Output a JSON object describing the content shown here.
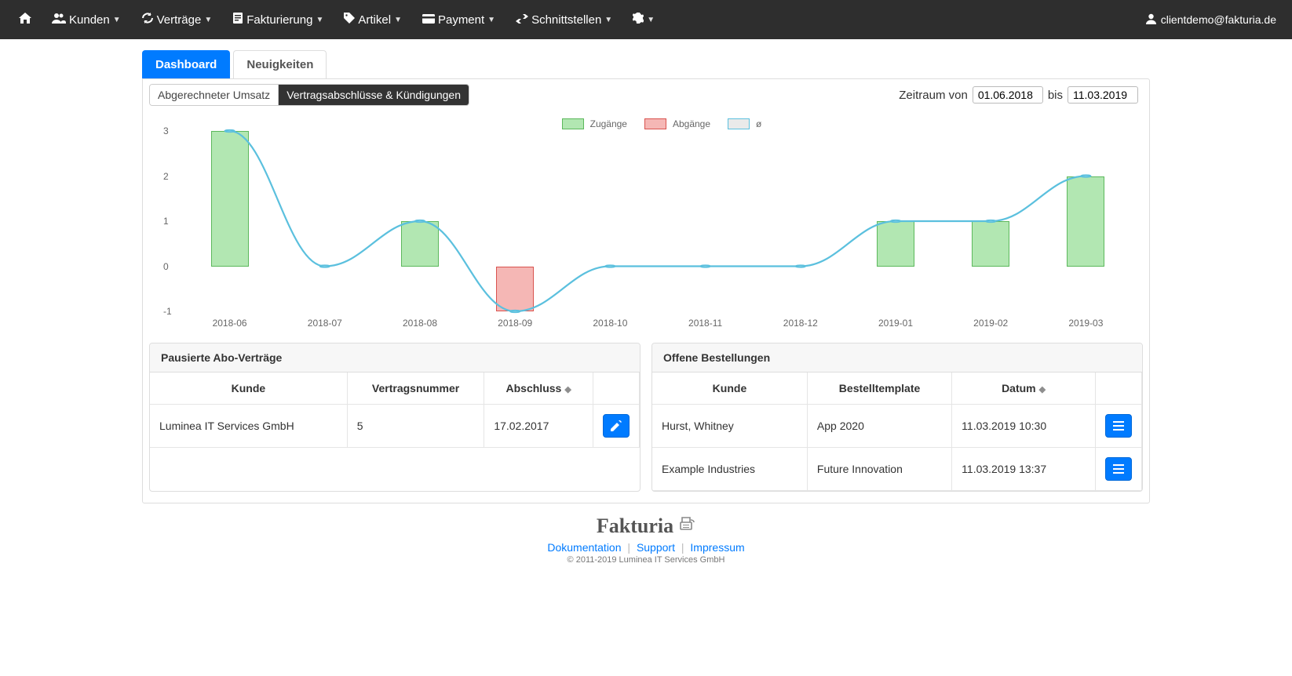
{
  "nav": {
    "kunden": "Kunden",
    "vertraege": "Verträge",
    "fakturierung": "Fakturierung",
    "artikel": "Artikel",
    "payment": "Payment",
    "schnittstellen": "Schnittstellen"
  },
  "user": {
    "email": "clientdemo@fakturia.de"
  },
  "tabs": {
    "dashboard": "Dashboard",
    "neuigkeiten": "Neuigkeiten"
  },
  "chart_tabs": {
    "umsatz": "Abgerechneter Umsatz",
    "vertrag": "Vertragsabschlüsse & Kündigungen"
  },
  "date_range": {
    "label_from": "Zeitraum von",
    "from": "01.06.2018",
    "label_to": "bis",
    "to": "11.03.2019"
  },
  "chart_legend": {
    "zugange": "Zugänge",
    "abgange": "Abgänge",
    "avg": "ø"
  },
  "chart_data": {
    "type": "bar+line",
    "categories": [
      "2018-06",
      "2018-07",
      "2018-08",
      "2018-09",
      "2018-10",
      "2018-11",
      "2018-12",
      "2019-01",
      "2019-02",
      "2019-03"
    ],
    "series": [
      {
        "name": "Zugänge",
        "type": "bar",
        "color": "#b2e7b2",
        "values": [
          3,
          0,
          1,
          0,
          0,
          0,
          0,
          1,
          1,
          2
        ]
      },
      {
        "name": "Abgänge",
        "type": "bar",
        "color": "#f5b7b5",
        "values": [
          0,
          0,
          0,
          -1,
          0,
          0,
          0,
          0,
          0,
          0
        ]
      },
      {
        "name": "ø",
        "type": "line",
        "color": "#5bc0de",
        "values": [
          3,
          0,
          1,
          -1,
          0,
          0,
          0,
          1,
          1,
          2
        ]
      }
    ],
    "y_ticks": [
      -1,
      0,
      1,
      2,
      3
    ],
    "ylim": [
      -1,
      3
    ],
    "title": "",
    "xlabel": "",
    "ylabel": ""
  },
  "cards": {
    "paused": {
      "title": "Pausierte Abo-Verträge",
      "cols": {
        "kunde": "Kunde",
        "vertrag": "Vertragsnummer",
        "abschluss": "Abschluss"
      },
      "rows": [
        {
          "kunde": "Luminea IT Services GmbH",
          "vertrag": "5",
          "abschluss": "17.02.2017"
        }
      ]
    },
    "open": {
      "title": "Offene Bestellungen",
      "cols": {
        "kunde": "Kunde",
        "template": "Bestelltemplate",
        "datum": "Datum"
      },
      "rows": [
        {
          "kunde": "Hurst, Whitney",
          "template": "App 2020",
          "datum": "11.03.2019 10:30"
        },
        {
          "kunde": "Example Industries",
          "template": "Future Innovation",
          "datum": "11.03.2019 13:37"
        }
      ]
    }
  },
  "footer": {
    "brand": "Fakturia",
    "docs": "Dokumentation",
    "support": "Support",
    "impressum": "Impressum",
    "copyright": "© 2011-2019 Luminea IT Services GmbH"
  }
}
